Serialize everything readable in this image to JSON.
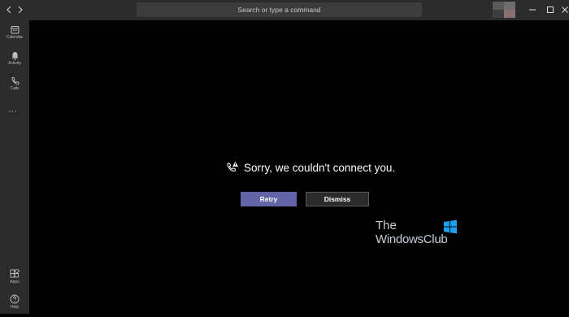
{
  "titlebar": {
    "back_icon": "chevron-left-icon",
    "forward_icon": "chevron-right-icon",
    "search_placeholder": "Search or type a command",
    "window_controls": [
      "minimize-icon",
      "maximize-icon",
      "close-icon"
    ]
  },
  "sidebar": {
    "items": [
      {
        "label": "Calendar",
        "icon": "calendar-icon"
      },
      {
        "label": "Activity",
        "icon": "bell-icon"
      },
      {
        "label": "Calls",
        "icon": "phone-icon"
      }
    ],
    "more_label": "···",
    "bottom_items": [
      {
        "label": "Apps",
        "icon": "apps-icon"
      },
      {
        "label": "Help",
        "icon": "help-icon"
      }
    ]
  },
  "main": {
    "error_icon": "call-warning-icon",
    "error_message": "Sorry, we couldn't connect you.",
    "retry_label": "Retry",
    "dismiss_label": "Dismiss",
    "accent_color": "#6264a7"
  },
  "watermark": {
    "line1": "The",
    "line2": "WindowsClub"
  }
}
